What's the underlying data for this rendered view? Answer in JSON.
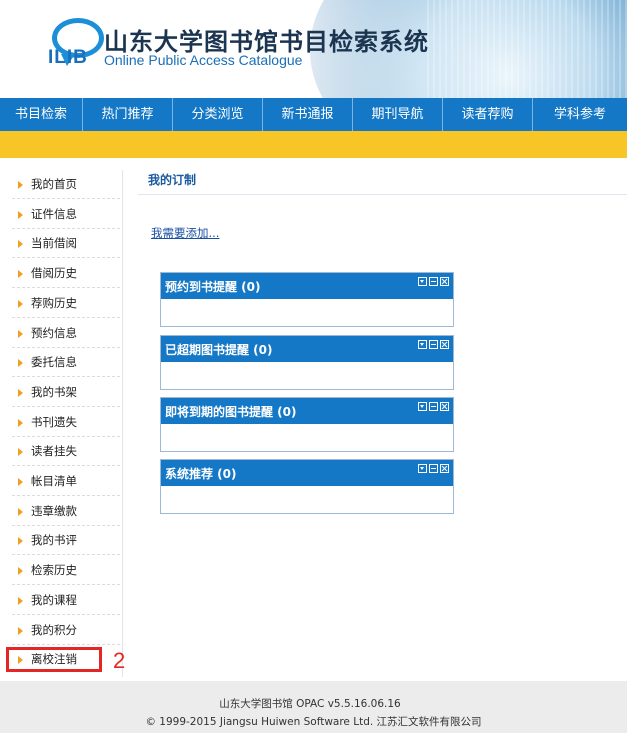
{
  "header": {
    "logo_text": "ILIB",
    "title": "山东大学图书馆书目检索系统",
    "subtitle": "Online Public Access Catalogue"
  },
  "nav": {
    "items": [
      {
        "label": "书目检索"
      },
      {
        "label": "热门推荐"
      },
      {
        "label": "分类浏览"
      },
      {
        "label": "新书通报"
      },
      {
        "label": "期刊导航"
      },
      {
        "label": "读者荐购"
      },
      {
        "label": "学科参考"
      }
    ]
  },
  "sidebar": {
    "items": [
      {
        "label": "我的首页"
      },
      {
        "label": "证件信息"
      },
      {
        "label": "当前借阅"
      },
      {
        "label": "借阅历史"
      },
      {
        "label": "荐购历史"
      },
      {
        "label": "预约信息"
      },
      {
        "label": "委托信息"
      },
      {
        "label": "我的书架"
      },
      {
        "label": "书刊遗失"
      },
      {
        "label": "读者挂失"
      },
      {
        "label": "帐目清单"
      },
      {
        "label": "违章缴款"
      },
      {
        "label": "我的书评"
      },
      {
        "label": "检索历史"
      },
      {
        "label": "我的课程"
      },
      {
        "label": "我的积分"
      },
      {
        "label": "离校注销"
      }
    ]
  },
  "annotation": {
    "number": "2"
  },
  "main": {
    "title": "我的订制",
    "add_link": "我需要添加..."
  },
  "panels": [
    {
      "title": "预约到书提醒 (0)"
    },
    {
      "title": "已超期图书提醒 (0)"
    },
    {
      "title": "即将到期的图书提醒 (0)"
    },
    {
      "title": "系统推荐 (0)"
    }
  ],
  "footer": {
    "line1": "山东大学图书馆   OPAC v5.5.16.06.16",
    "line2": "© 1999-2015 Jiangsu Huiwen Software Ltd. 江苏汇文软件有限公司"
  },
  "colors": {
    "nav_blue": "#1478c6",
    "accent_yellow": "#f7c526",
    "highlight_red": "#e32626",
    "link_blue": "#1a4fa0"
  }
}
